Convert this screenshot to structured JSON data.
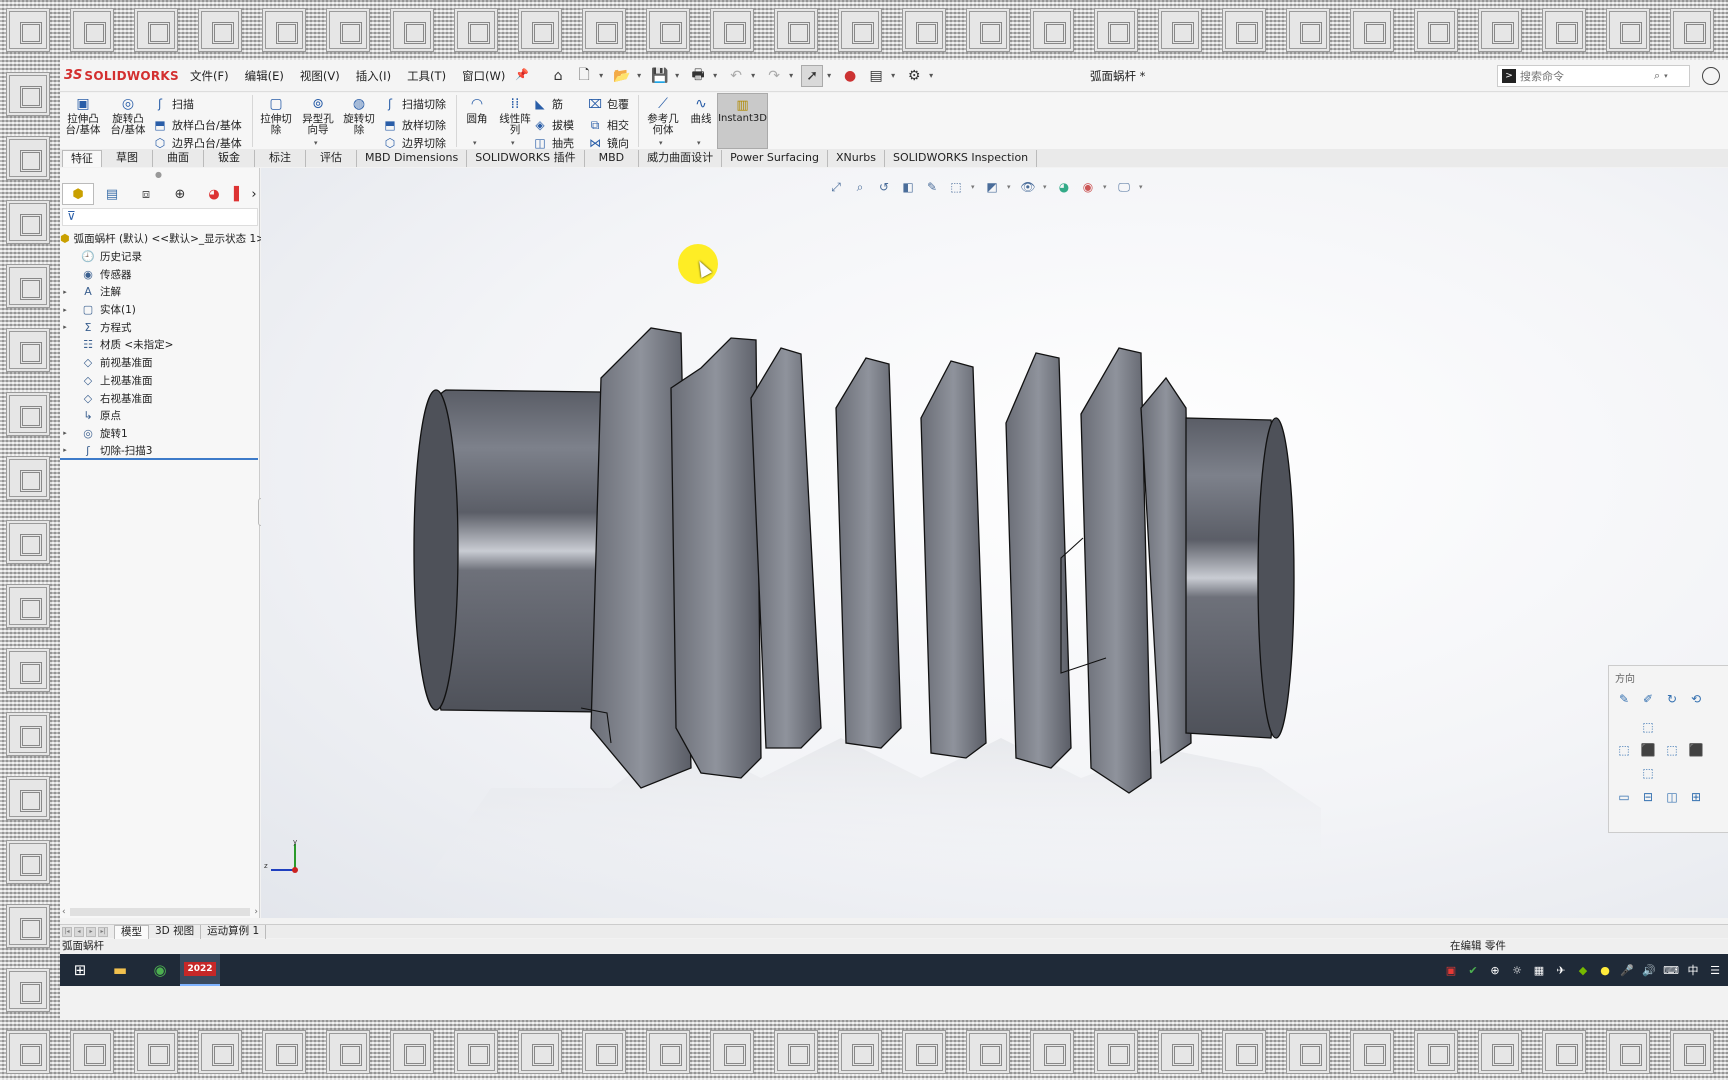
{
  "app": {
    "brand_ds": "3S",
    "brand": "SOLIDWORKS",
    "menu": [
      "文件(F)",
      "编辑(E)",
      "视图(V)",
      "插入(I)",
      "工具(T)",
      "窗口(W)"
    ],
    "doc_title": "弧面蜗杆 *",
    "search_placeholder": "搜索命令"
  },
  "ribbon": {
    "extrude_boss": "拉伸凸\n台/基体",
    "revolve_boss": "旋转凸\n台/基体",
    "sweep": "扫描",
    "loft_boss": "放样凸台/基体",
    "boundary_boss": "边界凸台/基体",
    "extrude_cut": "拉伸切\n除",
    "hole_wizard": "异型孔\n向导",
    "revolve_cut": "旋转切\n除",
    "swept_cut": "扫描切除",
    "lofted_cut": "放样切除",
    "boundary_cut": "边界切除",
    "fillet": "圆角",
    "linear_pattern": "线性阵\n列",
    "rib": "筋",
    "draft": "拔模",
    "shell": "抽壳",
    "wrap": "包覆",
    "intersect": "相交",
    "mirror": "镜向",
    "ref_geometry": "参考几\n何体",
    "curves": "曲线",
    "instant3d": "Instant3D"
  },
  "tabs": [
    "特征",
    "草图",
    "曲面",
    "钣金",
    "标注",
    "评估",
    "MBD Dimensions",
    "SOLIDWORKS 插件",
    "MBD",
    "威力曲面设计",
    "Power Surfacing",
    "XNurbs",
    "SOLIDWORKS Inspection"
  ],
  "tree": {
    "root": "弧面蜗杆 (默认) <<默认>_显示状态 1>",
    "items": [
      {
        "label": "历史记录",
        "icon": "history-icon",
        "expand": ""
      },
      {
        "label": "传感器",
        "icon": "sensor-icon",
        "expand": ""
      },
      {
        "label": "注解",
        "icon": "annotation-icon",
        "expand": "▸"
      },
      {
        "label": "实体(1)",
        "icon": "solid-bodies-icon",
        "expand": "▸"
      },
      {
        "label": "方程式",
        "icon": "equation-icon",
        "expand": "▸"
      },
      {
        "label": "材质 <未指定>",
        "icon": "material-icon",
        "expand": ""
      },
      {
        "label": "前视基准面",
        "icon": "plane-icon",
        "expand": ""
      },
      {
        "label": "上视基准面",
        "icon": "plane-icon",
        "expand": ""
      },
      {
        "label": "右视基准面",
        "icon": "plane-icon",
        "expand": ""
      },
      {
        "label": "原点",
        "icon": "origin-icon",
        "expand": ""
      },
      {
        "label": "旋转1",
        "icon": "revolve-feature-icon",
        "expand": "▸"
      },
      {
        "label": "切除-扫描3",
        "icon": "cut-sweep-feature-icon",
        "expand": "▸"
      }
    ]
  },
  "orientation": {
    "title": "方向"
  },
  "bottom_tabs": [
    "模型",
    "3D 视图",
    "运动算例 1"
  ],
  "status": {
    "left": "弧面蜗杆",
    "right": "在编辑 零件"
  },
  "taskbar": {
    "sw_label": "2022",
    "ime": "中"
  }
}
